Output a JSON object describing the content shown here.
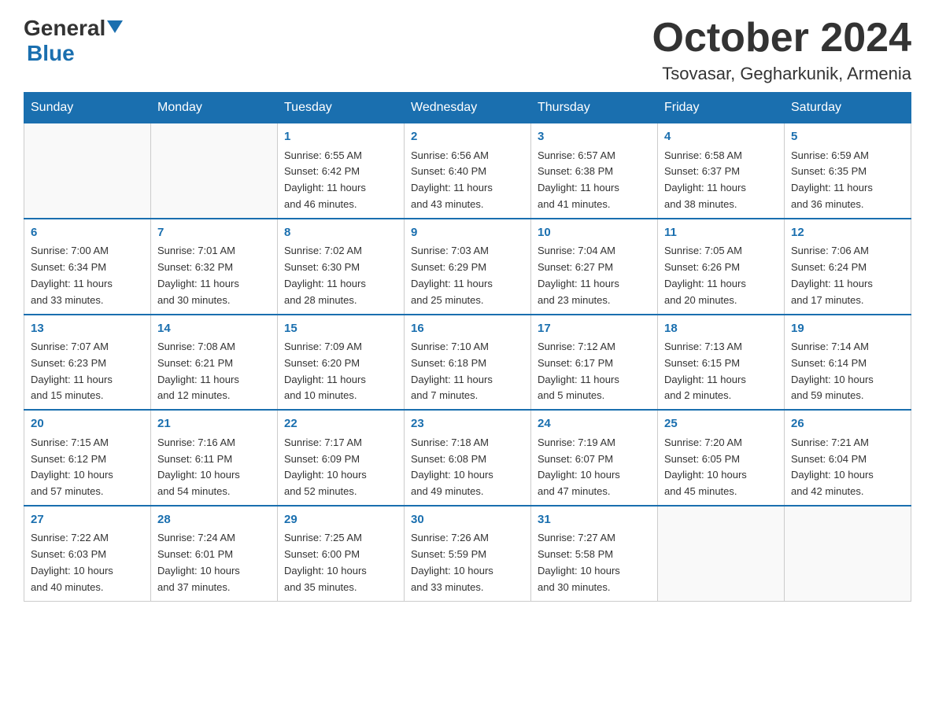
{
  "header": {
    "logo_general": "General",
    "logo_blue": "Blue",
    "month_title": "October 2024",
    "location": "Tsovasar, Gegharkunik, Armenia"
  },
  "weekdays": [
    "Sunday",
    "Monday",
    "Tuesday",
    "Wednesday",
    "Thursday",
    "Friday",
    "Saturday"
  ],
  "weeks": [
    [
      {
        "day": "",
        "info": ""
      },
      {
        "day": "",
        "info": ""
      },
      {
        "day": "1",
        "info": "Sunrise: 6:55 AM\nSunset: 6:42 PM\nDaylight: 11 hours\nand 46 minutes."
      },
      {
        "day": "2",
        "info": "Sunrise: 6:56 AM\nSunset: 6:40 PM\nDaylight: 11 hours\nand 43 minutes."
      },
      {
        "day": "3",
        "info": "Sunrise: 6:57 AM\nSunset: 6:38 PM\nDaylight: 11 hours\nand 41 minutes."
      },
      {
        "day": "4",
        "info": "Sunrise: 6:58 AM\nSunset: 6:37 PM\nDaylight: 11 hours\nand 38 minutes."
      },
      {
        "day": "5",
        "info": "Sunrise: 6:59 AM\nSunset: 6:35 PM\nDaylight: 11 hours\nand 36 minutes."
      }
    ],
    [
      {
        "day": "6",
        "info": "Sunrise: 7:00 AM\nSunset: 6:34 PM\nDaylight: 11 hours\nand 33 minutes."
      },
      {
        "day": "7",
        "info": "Sunrise: 7:01 AM\nSunset: 6:32 PM\nDaylight: 11 hours\nand 30 minutes."
      },
      {
        "day": "8",
        "info": "Sunrise: 7:02 AM\nSunset: 6:30 PM\nDaylight: 11 hours\nand 28 minutes."
      },
      {
        "day": "9",
        "info": "Sunrise: 7:03 AM\nSunset: 6:29 PM\nDaylight: 11 hours\nand 25 minutes."
      },
      {
        "day": "10",
        "info": "Sunrise: 7:04 AM\nSunset: 6:27 PM\nDaylight: 11 hours\nand 23 minutes."
      },
      {
        "day": "11",
        "info": "Sunrise: 7:05 AM\nSunset: 6:26 PM\nDaylight: 11 hours\nand 20 minutes."
      },
      {
        "day": "12",
        "info": "Sunrise: 7:06 AM\nSunset: 6:24 PM\nDaylight: 11 hours\nand 17 minutes."
      }
    ],
    [
      {
        "day": "13",
        "info": "Sunrise: 7:07 AM\nSunset: 6:23 PM\nDaylight: 11 hours\nand 15 minutes."
      },
      {
        "day": "14",
        "info": "Sunrise: 7:08 AM\nSunset: 6:21 PM\nDaylight: 11 hours\nand 12 minutes."
      },
      {
        "day": "15",
        "info": "Sunrise: 7:09 AM\nSunset: 6:20 PM\nDaylight: 11 hours\nand 10 minutes."
      },
      {
        "day": "16",
        "info": "Sunrise: 7:10 AM\nSunset: 6:18 PM\nDaylight: 11 hours\nand 7 minutes."
      },
      {
        "day": "17",
        "info": "Sunrise: 7:12 AM\nSunset: 6:17 PM\nDaylight: 11 hours\nand 5 minutes."
      },
      {
        "day": "18",
        "info": "Sunrise: 7:13 AM\nSunset: 6:15 PM\nDaylight: 11 hours\nand 2 minutes."
      },
      {
        "day": "19",
        "info": "Sunrise: 7:14 AM\nSunset: 6:14 PM\nDaylight: 10 hours\nand 59 minutes."
      }
    ],
    [
      {
        "day": "20",
        "info": "Sunrise: 7:15 AM\nSunset: 6:12 PM\nDaylight: 10 hours\nand 57 minutes."
      },
      {
        "day": "21",
        "info": "Sunrise: 7:16 AM\nSunset: 6:11 PM\nDaylight: 10 hours\nand 54 minutes."
      },
      {
        "day": "22",
        "info": "Sunrise: 7:17 AM\nSunset: 6:09 PM\nDaylight: 10 hours\nand 52 minutes."
      },
      {
        "day": "23",
        "info": "Sunrise: 7:18 AM\nSunset: 6:08 PM\nDaylight: 10 hours\nand 49 minutes."
      },
      {
        "day": "24",
        "info": "Sunrise: 7:19 AM\nSunset: 6:07 PM\nDaylight: 10 hours\nand 47 minutes."
      },
      {
        "day": "25",
        "info": "Sunrise: 7:20 AM\nSunset: 6:05 PM\nDaylight: 10 hours\nand 45 minutes."
      },
      {
        "day": "26",
        "info": "Sunrise: 7:21 AM\nSunset: 6:04 PM\nDaylight: 10 hours\nand 42 minutes."
      }
    ],
    [
      {
        "day": "27",
        "info": "Sunrise: 7:22 AM\nSunset: 6:03 PM\nDaylight: 10 hours\nand 40 minutes."
      },
      {
        "day": "28",
        "info": "Sunrise: 7:24 AM\nSunset: 6:01 PM\nDaylight: 10 hours\nand 37 minutes."
      },
      {
        "day": "29",
        "info": "Sunrise: 7:25 AM\nSunset: 6:00 PM\nDaylight: 10 hours\nand 35 minutes."
      },
      {
        "day": "30",
        "info": "Sunrise: 7:26 AM\nSunset: 5:59 PM\nDaylight: 10 hours\nand 33 minutes."
      },
      {
        "day": "31",
        "info": "Sunrise: 7:27 AM\nSunset: 5:58 PM\nDaylight: 10 hours\nand 30 minutes."
      },
      {
        "day": "",
        "info": ""
      },
      {
        "day": "",
        "info": ""
      }
    ]
  ]
}
